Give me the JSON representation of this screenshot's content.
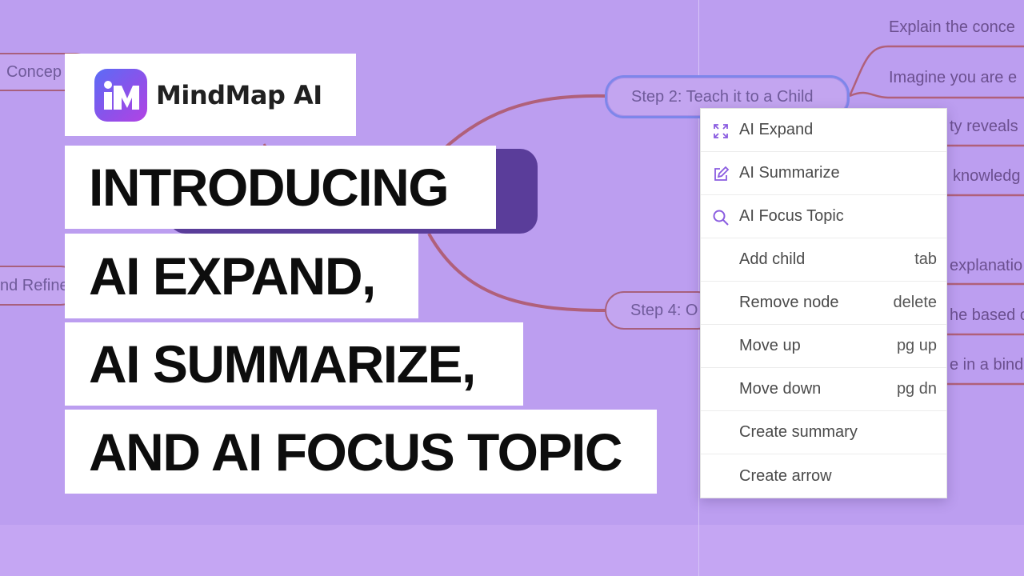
{
  "brand": {
    "name": "MindMap AI"
  },
  "headline": {
    "line1": "INTRODUCING",
    "line2": "AI EXPAND,",
    "line3": "AI SUMMARIZE,",
    "line4": "AND AI FOCUS TOPIC"
  },
  "mindmap": {
    "left_nodes": [
      "Concep",
      "nd Refine"
    ],
    "step2": "Step 2: Teach it to a Child",
    "step4": "Step 4: O",
    "right_nodes": [
      "Explain the conce",
      "Imagine you are e",
      "ty reveals",
      "knowledg",
      "explanatio",
      "he based o",
      "e in a bind"
    ]
  },
  "context_menu": {
    "items": [
      {
        "label": "AI Expand",
        "shortcut": "",
        "icon": "expand-icon"
      },
      {
        "label": "AI Summarize",
        "shortcut": "",
        "icon": "edit-icon"
      },
      {
        "label": "AI Focus Topic",
        "shortcut": "",
        "icon": "search-icon"
      },
      {
        "label": "Add child",
        "shortcut": "tab",
        "icon": ""
      },
      {
        "label": "Remove node",
        "shortcut": "delete",
        "icon": ""
      },
      {
        "label": "Move up",
        "shortcut": "pg up",
        "icon": ""
      },
      {
        "label": "Move down",
        "shortcut": "pg dn",
        "icon": ""
      },
      {
        "label": "Create summary",
        "shortcut": "",
        "icon": ""
      },
      {
        "label": "Create arrow",
        "shortcut": "",
        "icon": ""
      }
    ]
  },
  "colors": {
    "background": "#bc9ef0",
    "connector": "#b0607a",
    "root_node": "#5a3d9a",
    "selected_border": "#7e86ea",
    "icon_accent": "#8a5ce0"
  }
}
